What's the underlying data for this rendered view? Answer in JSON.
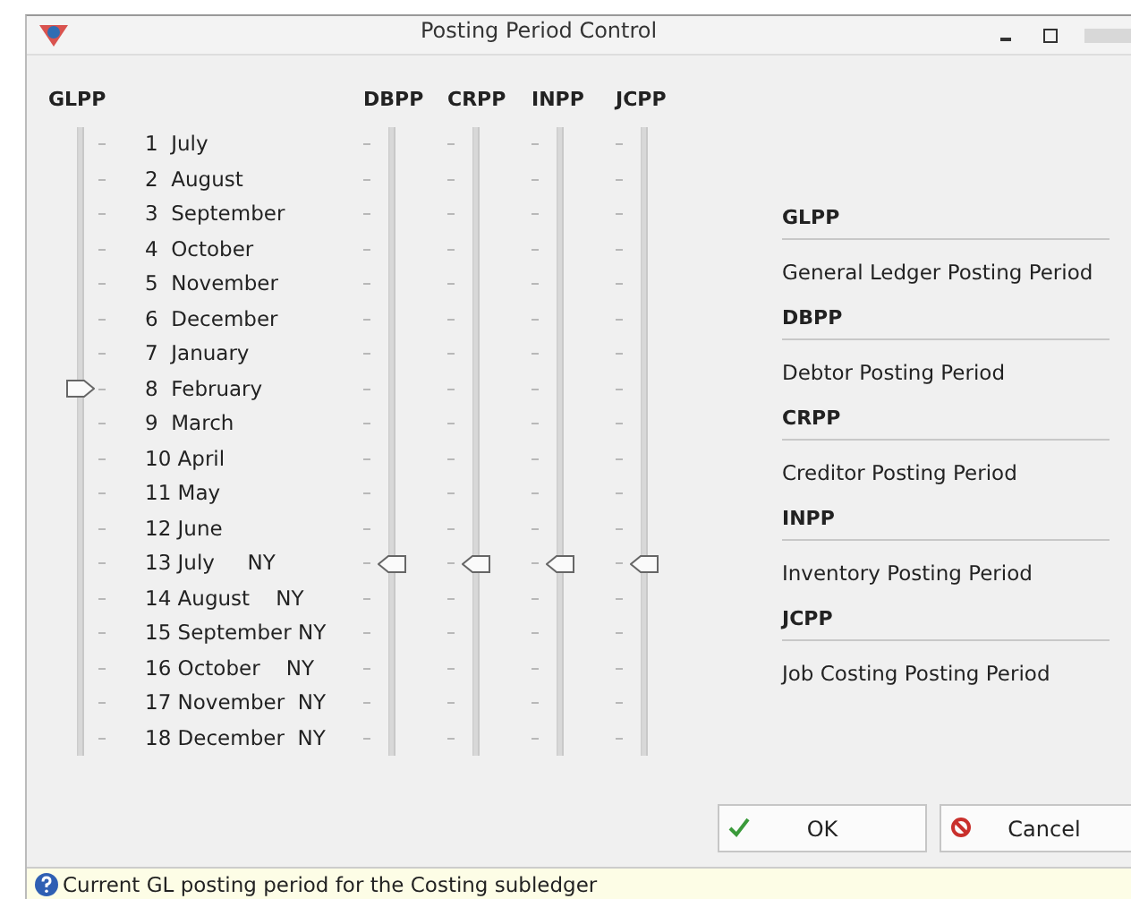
{
  "window": {
    "title": "Posting Period Control"
  },
  "glpp": {
    "label": "GLPP",
    "kind": "ticks-right"
  },
  "periods": [
    "1  July",
    "2  August",
    "3  September",
    "4  October",
    "5  November",
    "6  December",
    "7  January",
    "8  February",
    "9  March",
    "10 April",
    "11 May",
    "12 June",
    "13 July     NY",
    "14 August    NY",
    "15 September NY",
    "16 October    NY",
    "17 November  NY",
    "18 December  NY"
  ],
  "sliders": [
    {
      "label": "DBPP",
      "kind": "ticks-left"
    },
    {
      "label": "CRPP",
      "kind": "ticks-left"
    },
    {
      "label": "INPP",
      "kind": "ticks-left"
    },
    {
      "label": "JCPP",
      "kind": "ticks-left"
    }
  ],
  "legend": [
    {
      "code": "GLPP",
      "description": "General Ledger Posting Period"
    },
    {
      "code": "DBPP",
      "description": "Debtor Posting Period"
    },
    {
      "code": "CRPP",
      "description": "Creditor Posting Period"
    },
    {
      "code": "INPP",
      "description": "Inventory Posting Period"
    },
    {
      "code": "JCPP",
      "description": "Job Costing Posting Period"
    }
  ],
  "buttons": [
    {
      "label": "OK",
      "kind": "ok"
    },
    {
      "label": "Cancel",
      "kind": "cancel"
    }
  ],
  "status_bar": {
    "text": "Current GL posting period for the Costing subledger"
  }
}
